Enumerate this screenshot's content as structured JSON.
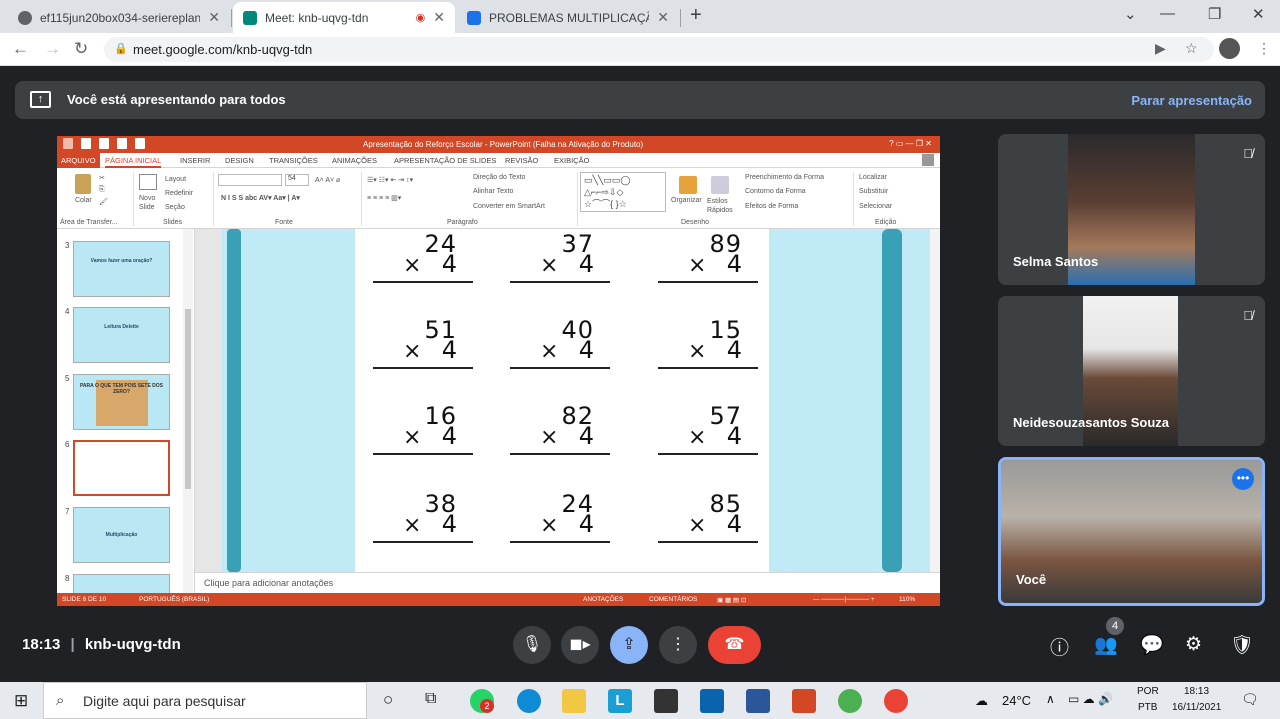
{
  "browser": {
    "tabs": [
      {
        "label": "ef115jun20box034-seriereplanejan",
        "active": false
      },
      {
        "label": "Meet: knb-uqvg-tdn",
        "active": true
      },
      {
        "label": "PROBLEMAS MULTIPLICAÇÃO - G",
        "active": false
      }
    ],
    "url": "meet.google.com/knb-uqvg-tdn"
  },
  "banner": {
    "text": "Você está apresentando para todos",
    "stop_label": "Parar apresentação"
  },
  "powerpoint": {
    "title": "Apresentação do Reforço Escolar - PowerPoint (Falha na Ativação do Produto)",
    "ribbon_tabs": [
      "ARQUIVO",
      "PÁGINA INICIAL",
      "INSERIR",
      "DESIGN",
      "TRANSIÇÕES",
      "ANIMAÇÕES",
      "APRESENTAÇÃO DE SLIDES",
      "REVISÃO",
      "EXIBIÇÃO"
    ],
    "ribbon": {
      "paste": "Colar",
      "new_slide": "Novo Slide",
      "layout": "Layout",
      "reset": "Redefinir",
      "section": "Seção",
      "font_size": "54",
      "text_direction": "Direção do Texto",
      "align_text": "Alinhar Texto",
      "smartart": "Converter em SmartArt",
      "arrange": "Organizar",
      "quick_styles": "Estilos Rápidos",
      "shape_fill": "Preenchimento da Forma",
      "shape_outline": "Contorno da Forma",
      "shape_effects": "Efeitos de Forma",
      "find": "Localizar",
      "replace": "Substituir",
      "select": "Selecionar",
      "group_clipboard": "Área de Transfer...",
      "group_slides": "Slides",
      "group_font": "Fonte",
      "group_paragraph": "Parágrafo",
      "group_drawing": "Desenho",
      "group_editing": "Edição"
    },
    "thumbnails": [
      {
        "num": "3",
        "title": "Vamos fazer uma oração?",
        "selected": false
      },
      {
        "num": "4",
        "title": "Leitura Deleite",
        "selected": false
      },
      {
        "num": "5",
        "title": "PARA O QUE TEM POIS SETE DOS ZERO?",
        "selected": false
      },
      {
        "num": "6",
        "title": "",
        "selected": true
      },
      {
        "num": "7",
        "title": "Multiplicação",
        "selected": false
      },
      {
        "num": "8",
        "title": "",
        "selected": false
      }
    ],
    "problems": [
      {
        "top": "24",
        "bottom": "4"
      },
      {
        "top": "37",
        "bottom": "4"
      },
      {
        "top": "89",
        "bottom": "4"
      },
      {
        "top": "51",
        "bottom": "4"
      },
      {
        "top": "40",
        "bottom": "4"
      },
      {
        "top": "15",
        "bottom": "4"
      },
      {
        "top": "16",
        "bottom": "4"
      },
      {
        "top": "82",
        "bottom": "4"
      },
      {
        "top": "57",
        "bottom": "4"
      },
      {
        "top": "38",
        "bottom": "4"
      },
      {
        "top": "24",
        "bottom": "4"
      },
      {
        "top": "85",
        "bottom": "4"
      }
    ],
    "notes_placeholder": "Clique para adicionar anotações",
    "status": {
      "slide": "SLIDE 6 DE 10",
      "language": "PORTUGUÊS (BRASIL)",
      "notes": "ANOTAÇÕES",
      "comments": "COMENTÁRIOS",
      "zoom": "110%"
    }
  },
  "participants": [
    {
      "name": "Selma Santos",
      "muted": true
    },
    {
      "name": "Neidesouzasantos Souza",
      "muted": true
    },
    {
      "name": "Você",
      "muted": false
    }
  ],
  "meet": {
    "time": "18:13",
    "code": "knb-uqvg-tdn",
    "people_count": "4"
  },
  "taskbar": {
    "search_placeholder": "Digite aqui para pesquisar",
    "temperature": "24°C",
    "lang_top": "POR",
    "lang_bottom": "PTB",
    "clock_time": "18:13",
    "clock_date": "16/11/2021",
    "whatsapp_badge": "2"
  }
}
